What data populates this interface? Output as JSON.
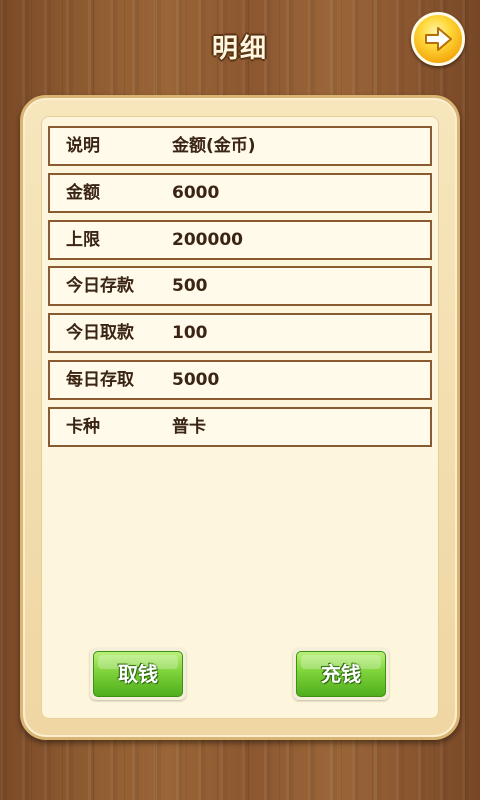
{
  "header": {
    "title": "明细",
    "next_icon": "arrow-right-icon"
  },
  "details": {
    "rows": [
      {
        "label": "说明",
        "value": "金额(金币)"
      },
      {
        "label": "金额",
        "value": "6000"
      },
      {
        "label": "上限",
        "value": "200000"
      },
      {
        "label": "今日存款",
        "value": "500"
      },
      {
        "label": "今日取款",
        "value": "100"
      },
      {
        "label": "每日存取",
        "value": "5000"
      },
      {
        "label": "卡种",
        "value": "普卡"
      }
    ]
  },
  "actions": {
    "withdraw_label": "取钱",
    "deposit_label": "充钱"
  },
  "colors": {
    "accent_green": "#7ed33a",
    "row_border": "#8a5a30",
    "arrow_button": "#f5a80d"
  }
}
